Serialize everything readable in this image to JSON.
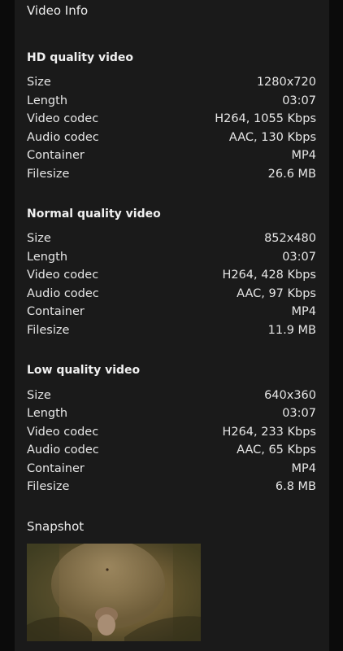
{
  "header": {
    "title": "Video Info"
  },
  "qualities": [
    {
      "title": "HD quality video",
      "rows": [
        {
          "label": "Size",
          "value": "1280x720"
        },
        {
          "label": "Length",
          "value": "03:07"
        },
        {
          "label": "Video codec",
          "value": "H264, 1055 Kbps"
        },
        {
          "label": "Audio codec",
          "value": "AAC, 130 Kbps"
        },
        {
          "label": "Container",
          "value": "MP4"
        },
        {
          "label": "Filesize",
          "value": "26.6 MB"
        }
      ]
    },
    {
      "title": "Normal quality video",
      "rows": [
        {
          "label": "Size",
          "value": "852x480"
        },
        {
          "label": "Length",
          "value": "03:07"
        },
        {
          "label": "Video codec",
          "value": "H264, 428 Kbps"
        },
        {
          "label": "Audio codec",
          "value": "AAC, 97 Kbps"
        },
        {
          "label": "Container",
          "value": "MP4"
        },
        {
          "label": "Filesize",
          "value": "11.9 MB"
        }
      ]
    },
    {
      "title": "Low quality video",
      "rows": [
        {
          "label": "Size",
          "value": "640x360"
        },
        {
          "label": "Length",
          "value": "03:07"
        },
        {
          "label": "Video codec",
          "value": "H264, 233 Kbps"
        },
        {
          "label": "Audio codec",
          "value": "AAC, 65 Kbps"
        },
        {
          "label": "Container",
          "value": "MP4"
        },
        {
          "label": "Filesize",
          "value": "6.8 MB"
        }
      ]
    }
  ],
  "snapshot": {
    "label": "Snapshot"
  },
  "colors": {
    "page_background": "#0b0b0b",
    "panel_background": "#1a1a1a",
    "text": "#e6e6e6"
  }
}
